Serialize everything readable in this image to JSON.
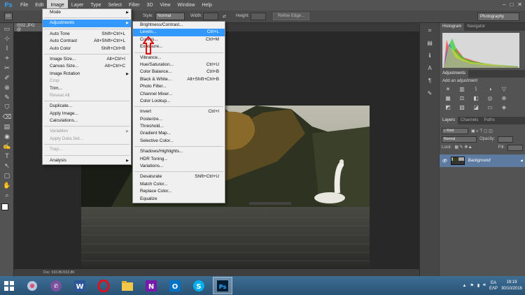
{
  "app": {
    "logo": "Ps"
  },
  "menubar": {
    "items": [
      "File",
      "Edit",
      "Image",
      "Layer",
      "Type",
      "Select",
      "Filter",
      "3D",
      "View",
      "Window",
      "Help"
    ],
    "active": "Image"
  },
  "options": {
    "style_label": "Style:",
    "style_value": "Normal",
    "width_label": "Width:",
    "height_label": "Height:",
    "refine_edge": "Refine Edge...",
    "workspace": "Photography"
  },
  "document": {
    "tab": "IS02.JPG @",
    "status": "Doc: 933.8K/933.8K"
  },
  "image_menu": {
    "items": [
      {
        "label": "Mode",
        "submenu": true
      },
      {
        "sep": true
      },
      {
        "label": "Adjustments",
        "submenu": true,
        "highlight": true
      },
      {
        "sep": true
      },
      {
        "label": "Auto Tone",
        "shortcut": "Shift+Ctrl+L"
      },
      {
        "label": "Auto Contrast",
        "shortcut": "Alt+Shift+Ctrl+L"
      },
      {
        "label": "Auto Color",
        "shortcut": "Shift+Ctrl+B"
      },
      {
        "sep": true
      },
      {
        "label": "Image Size...",
        "shortcut": "Alt+Ctrl+I"
      },
      {
        "label": "Canvas Size...",
        "shortcut": "Alt+Ctrl+C"
      },
      {
        "label": "Image Rotation",
        "submenu": true
      },
      {
        "label": "Crop",
        "disabled": true
      },
      {
        "label": "Trim..."
      },
      {
        "label": "Reveal All",
        "disabled": true
      },
      {
        "sep": true
      },
      {
        "label": "Duplicate..."
      },
      {
        "label": "Apply Image..."
      },
      {
        "label": "Calculations..."
      },
      {
        "sep": true
      },
      {
        "label": "Variables",
        "submenu": true,
        "disabled": true
      },
      {
        "label": "Apply Data Set...",
        "disabled": true
      },
      {
        "sep": true
      },
      {
        "label": "Trap...",
        "disabled": true
      },
      {
        "sep": true
      },
      {
        "label": "Analysis",
        "submenu": true
      }
    ]
  },
  "adjust_menu": {
    "items": [
      {
        "label": "Brightness/Contrast..."
      },
      {
        "label": "Levels...",
        "shortcut": "Ctrl+L",
        "highlight": true
      },
      {
        "label": "Curves...",
        "shortcut": "Ctrl+M"
      },
      {
        "label": "Exposure..."
      },
      {
        "sep": true
      },
      {
        "label": "Vibrance..."
      },
      {
        "label": "Hue/Saturation...",
        "shortcut": "Ctrl+U"
      },
      {
        "label": "Color Balance...",
        "shortcut": "Ctrl+B"
      },
      {
        "label": "Black & White...",
        "shortcut": "Alt+Shift+Ctrl+B"
      },
      {
        "label": "Photo Filter..."
      },
      {
        "label": "Channel Mixer..."
      },
      {
        "label": "Color Lookup..."
      },
      {
        "sep": true
      },
      {
        "label": "Invert",
        "shortcut": "Ctrl+I"
      },
      {
        "label": "Posterize..."
      },
      {
        "label": "Threshold..."
      },
      {
        "label": "Gradient Map..."
      },
      {
        "label": "Selective Color..."
      },
      {
        "sep": true
      },
      {
        "label": "Shadows/Highlights..."
      },
      {
        "label": "HDR Toning..."
      },
      {
        "label": "Variations..."
      },
      {
        "sep": true
      },
      {
        "label": "Desaturate",
        "shortcut": "Shift+Ctrl+U"
      },
      {
        "label": "Match Color..."
      },
      {
        "label": "Replace Color..."
      },
      {
        "label": "Equalize"
      }
    ]
  },
  "panels": {
    "top_tabs": [
      "Histogram",
      "Navigator"
    ],
    "adjustments_tab": "Adjustments",
    "add_adjustment": "Add an adjustment",
    "layer_tabs": [
      "Layers",
      "Channels",
      "Paths"
    ],
    "kind": "Kind",
    "blend": "Normal",
    "opacity_label": "Opacity:",
    "lock_label": "Lock:",
    "fill_label": "Fill:",
    "layer_name": "Background"
  },
  "taskbar": {
    "apps": [
      "word",
      "opera",
      "explorer",
      "onenote",
      "outlook",
      "skype",
      "photoshop"
    ],
    "lang_top": "EA",
    "lang_bottom": "ΕΛΡ",
    "time": "19:19",
    "date": "30/10/2016"
  },
  "colors": {
    "accent": "#3399ff",
    "menubar": "#535353",
    "canvas": "#282828"
  }
}
